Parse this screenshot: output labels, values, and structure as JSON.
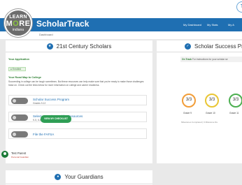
{
  "header": {
    "logo": {
      "line1": "LEARN",
      "line2a": "M",
      "line2b": "O",
      "line2c": "RE",
      "line3": "indiana"
    },
    "brand": "ScholarTrack",
    "subtitle": "Dashboard",
    "nav": [
      "My Dashboard",
      "My Stats",
      "My A"
    ],
    "corner_glyph": "T"
  },
  "scholars_panel": {
    "title": "21st Century Scholars",
    "application_label": "Your Application",
    "application_status": "Enrolled",
    "roadmap_label": "Your Road Map to College",
    "roadmap_text": "Succeeding in college can be tough sometimes. But these resources can help make sure that you're ready to make those challenges head on. Check out the links below for more information on college and career readiness.",
    "resources": [
      {
        "title": "Scholar Success Program",
        "subtitle": "Grades 9-12"
      },
      {
        "title": "Select a Grade Level for Resources",
        "subtitle": "K-5, 6-8, High School, College"
      },
      {
        "title": "File the FAFSA",
        "subtitle": ""
      }
    ]
  },
  "success_panel": {
    "title": "Scholar Success Pr",
    "tip_status": "On Track",
    "tip_text": "For instructions for your scholar se",
    "grades": [
      {
        "score": "3/3",
        "label": "Grade 9",
        "color": "#f29d38"
      },
      {
        "score": "3/3",
        "label": "Grade 10",
        "color": "#e9c634"
      },
      {
        "score": "3/3",
        "label": "Grade 11",
        "color": "#4caf50"
      }
    ],
    "milestone_note": "Milestones Completed | 0 Milestone Re",
    "checklist_button": "VIEW MY CHECKLIST"
  },
  "guardians_panel": {
    "title": "Your Guardians",
    "name": "Test Parent",
    "role": "Personal Guardian"
  },
  "colors": {
    "accent": "#1f6fb2",
    "success": "#2e9e55",
    "page_bg": "#e9e9e9"
  }
}
